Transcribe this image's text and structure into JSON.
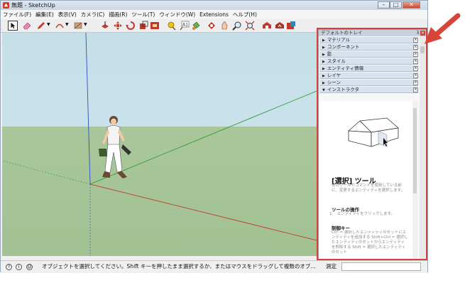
{
  "window": {
    "title": "無題 - SketchUp"
  },
  "menu": [
    "ファイル(F)",
    "編集(E)",
    "表示(V)",
    "カメラ(C)",
    "描画(R)",
    "ツール(T)",
    "ウィンドウ(W)",
    "Extensions",
    "ヘルプ(H)"
  ],
  "tray": {
    "title": "デフォルトのトレイ",
    "panels": [
      "マテリアル",
      "コンポーネント",
      "影",
      "スタイル",
      "エンティティ情報",
      "レイヤ",
      "シーン",
      "インストラクタ"
    ]
  },
  "instructor": {
    "heading": "[選択] ツール",
    "description": "他のツールやコマンドを使用している前に、変更するエンティティを選択します。",
    "op_title": "ツールの操作",
    "op_step": "1.　エンティティをクリックします。",
    "keys_title": "制御キー",
    "keys_text": "Ctrl = 選択したエンティティのセットにエンティティを追加する Shift+Ctrl = 選択したエンティティのセットからエンティティを削除する Shift = 選択したエンティティのセット"
  },
  "status": {
    "hint": "オブジェクトを選択してください。Shift キーを押したまま選択するか、またはマウスをドラッグして複数のオブ...",
    "measure_label": "測定",
    "measure_value": ""
  },
  "colors": {
    "highlight": "#d6423a",
    "arrow": "#d6453a",
    "sky": "#c7e0e9",
    "ground": "#a4c396",
    "axis_red": "#c0392b",
    "axis_green": "#2e9e3a",
    "axis_blue": "#2f4fbf"
  },
  "icons": [
    "select-icon",
    "eraser-icon",
    "pencil-icon",
    "arc-icon",
    "rectangle-icon",
    "push-pull-icon",
    "move-icon",
    "rotate-icon",
    "scale-icon",
    "offset-icon",
    "tape-measure-icon",
    "text-icon",
    "paint-bucket-icon",
    "orbit-icon",
    "pan-icon",
    "zoom-icon",
    "zoom-extents-icon",
    "warehouse-icon",
    "share-model-icon",
    "extension-warehouse-icon"
  ]
}
